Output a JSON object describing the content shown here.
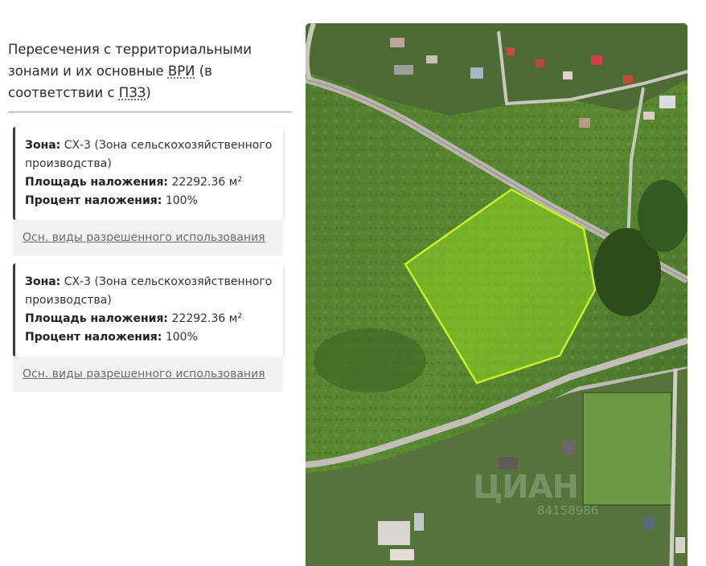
{
  "section": {
    "title_part1": "Пересечения с территориальными зонами и их основные ",
    "title_abbr1": "ВРИ",
    "title_part2": " (в соответствии с ",
    "title_abbr2": "ПЗЗ",
    "title_part3": ")"
  },
  "zones": [
    {
      "zone_label": "Зона:",
      "zone_value": "СХ-3 (Зона сельскохозяйственного производства)",
      "area_label": "Площадь наложения:",
      "area_value": "22292.36 м",
      "area_unit_sup": "2",
      "percent_label": "Процент наложения:",
      "percent_value": "100%",
      "link_label": "Осн. виды разрешенного использования"
    },
    {
      "zone_label": "Зона:",
      "zone_value": "СХ-3 (Зона сельскохозяйственного производства)",
      "area_label": "Площадь наложения:",
      "area_value": "22292.36 м",
      "area_unit_sup": "2",
      "percent_label": "Процент наложения:",
      "percent_value": "100%",
      "link_label": "Осн. виды разрешенного использования"
    }
  ],
  "map": {
    "watermark": "ЦИАН",
    "watermark_id": "84158986",
    "plot_outline_color": "#c6f22a",
    "plot_fill_color": "#8fd61f"
  }
}
